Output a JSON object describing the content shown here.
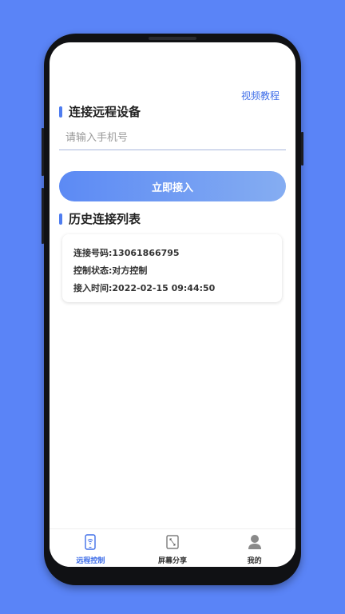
{
  "header": {
    "tutorial_link": "视频教程"
  },
  "connect": {
    "section_title": "连接远程设备",
    "phone_placeholder": "请输入手机号",
    "phone_value": "",
    "connect_button": "立即接入"
  },
  "history": {
    "section_title": "历史连接列表",
    "items": [
      {
        "number": "连接号码:13061866795",
        "status": "控制状态:对方控制",
        "time": "接入时间:2022-02-15 09:44:50"
      }
    ]
  },
  "tabbar": {
    "tabs": [
      {
        "label": "远程控制",
        "icon": "phone-wifi-icon",
        "active": true
      },
      {
        "label": "屏幕分享",
        "icon": "screen-share-icon",
        "active": false
      },
      {
        "label": "我的",
        "icon": "user-icon",
        "active": false
      }
    ]
  },
  "colors": {
    "background": "#5a84f7",
    "accent": "#3f6ee8",
    "button_start": "#5c8af4",
    "button_end": "#85adf2"
  }
}
